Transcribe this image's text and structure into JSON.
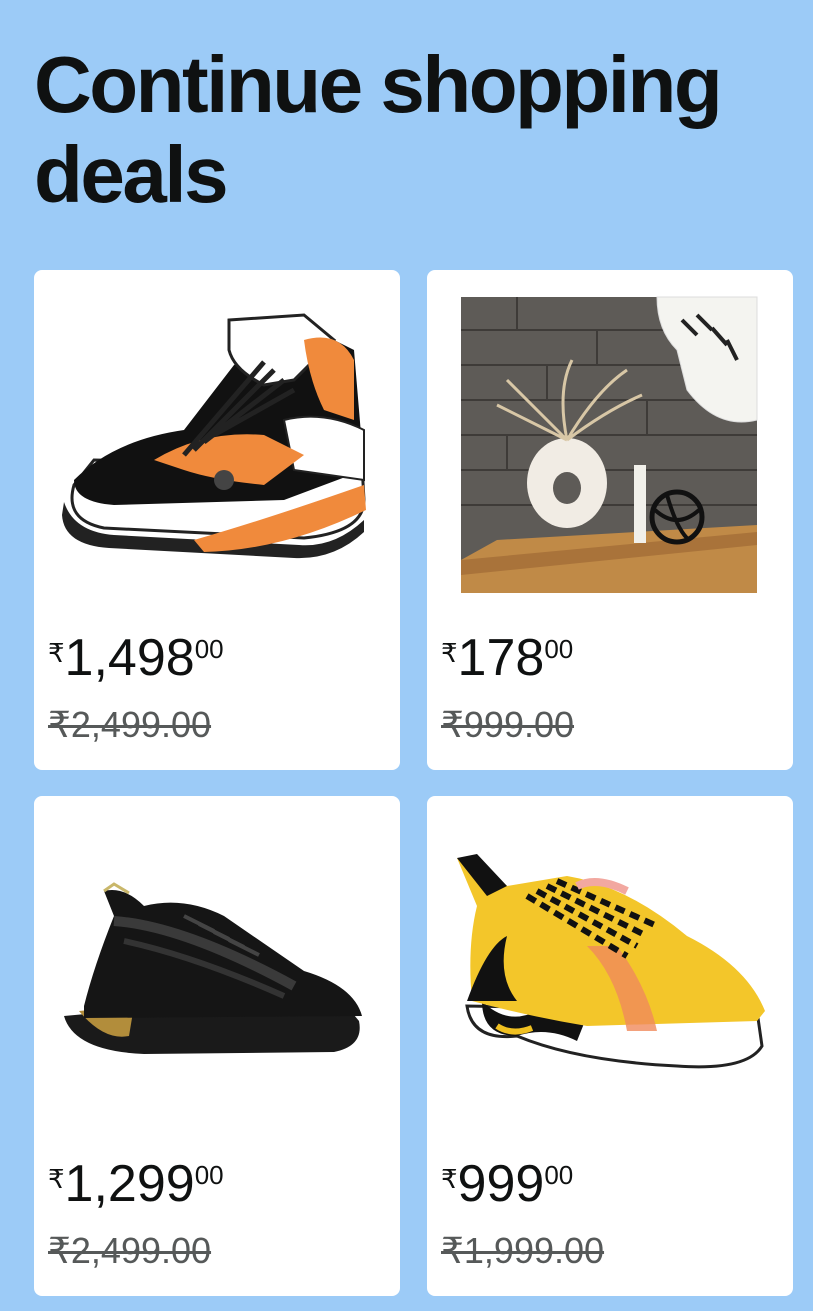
{
  "title": "Continue shopping deals",
  "currency_symbol": "₹",
  "products": [
    {
      "image_icon": "basketball-shoe-image",
      "price_whole": "1,498",
      "price_fraction": "00",
      "mrp": "₹2,499.00"
    },
    {
      "image_icon": "vase-decor-image",
      "price_whole": "178",
      "price_fraction": "00",
      "mrp": "₹999.00"
    },
    {
      "image_icon": "black-running-shoe-image",
      "price_whole": "1,299",
      "price_fraction": "00",
      "mrp": "₹2,499.00"
    },
    {
      "image_icon": "yellow-running-shoe-image",
      "price_whole": "999",
      "price_fraction": "00",
      "mrp": "₹1,999.00"
    }
  ],
  "colors": {
    "background": "#9ccbf7",
    "card": "#ffffff",
    "text": "#0f1111",
    "mrp_text": "#565959"
  }
}
